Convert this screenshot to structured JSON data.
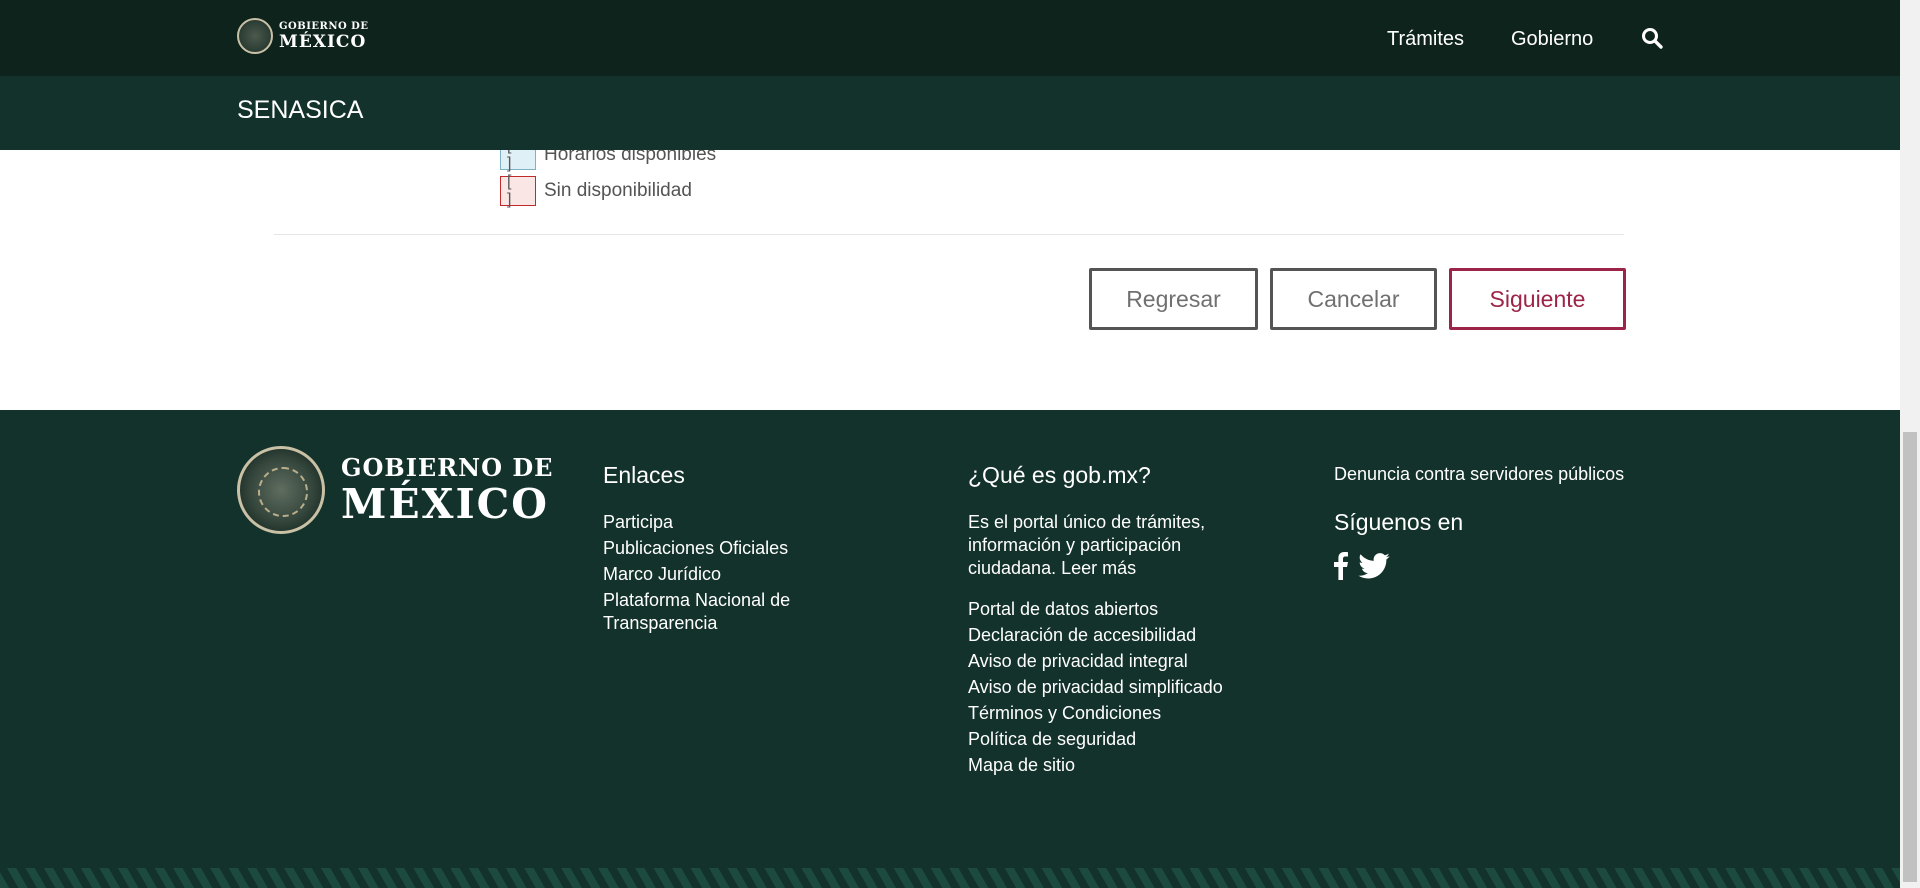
{
  "topbar": {
    "logo": {
      "line1": "GOBIERNO DE",
      "line2": "MÉXICO"
    },
    "nav": {
      "tramites": "Trámites",
      "gobierno": "Gobierno"
    },
    "search_icon": "search-icon"
  },
  "subbar": {
    "title": "SENASICA"
  },
  "legend": {
    "available": {
      "box": "[ ]",
      "label": "Horarios disponibles"
    },
    "unavailable": {
      "box": "[ ]",
      "label": "Sin disponibilidad"
    }
  },
  "actions": {
    "regresar": "Regresar",
    "cancelar": "Cancelar",
    "siguiente": "Siguiente"
  },
  "footer": {
    "logo": {
      "line1": "GOBIERNO DE",
      "line2": "MÉXICO"
    },
    "enlaces": {
      "title": "Enlaces",
      "links": [
        "Participa",
        "Publicaciones Oficiales",
        "Marco Jurídico",
        "Plataforma Nacional de Transparencia"
      ]
    },
    "que_es": {
      "title": "¿Qué es gob.mx?",
      "description": "Es el portal único de trámites, información y participación ciudadana.",
      "leer_mas": "Leer más",
      "links": [
        "Portal de datos abiertos",
        "Declaración de accesibilidad",
        "Aviso de privacidad integral",
        "Aviso de privacidad simplificado",
        "Términos y Condiciones",
        "Política de seguridad",
        "Mapa de sitio"
      ]
    },
    "denuncia": "Denuncia contra servidores públicos",
    "siguenos": "Síguenos en",
    "social_icons": [
      "facebook-icon",
      "twitter-icon"
    ]
  },
  "colors": {
    "topbar": "#0f231d",
    "subbar": "#13322b",
    "footer": "#13322b",
    "primary_button": "#9d2449"
  }
}
